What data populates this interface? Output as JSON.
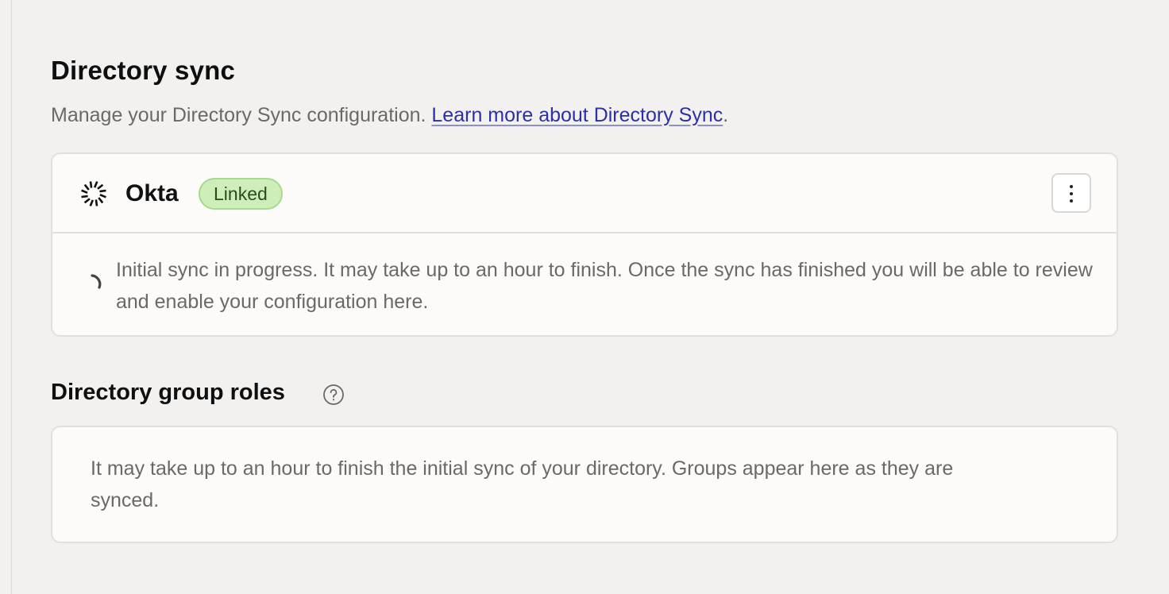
{
  "directory_sync": {
    "title": "Directory sync",
    "description": "Manage your Directory Sync configuration. ",
    "learn_more_link": "Learn more about Directory Sync",
    "description_suffix": "."
  },
  "provider_card": {
    "logo_icon": "okta-sunburst-icon",
    "provider_name": "Okta",
    "status_badge": "Linked",
    "status_color": "#cdeeb8",
    "menu_icon": "more-vertical-icon",
    "progress_icon": "loading-spinner-icon",
    "progress_message": "Initial sync in progress. It may take up to an hour to finish. Once the sync has finished you will be able to review and enable your configuration here."
  },
  "group_roles": {
    "title": "Directory group roles",
    "help_icon": "question-circle-icon",
    "empty_message": "It may take up to an hour to finish the initial sync of your directory. Groups appear here as they are synced."
  },
  "colors": {
    "background": "#f3f1ef",
    "card_background": "#fcfbfa",
    "link": "#2b2fa8",
    "muted_text": "#6b6966"
  }
}
